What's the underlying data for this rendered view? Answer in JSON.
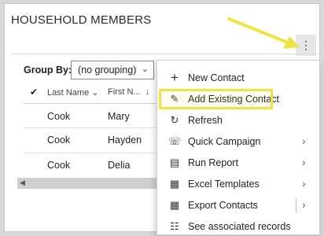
{
  "panel": {
    "title": "HOUSEHOLD MEMBERS",
    "more_icon": "⋮"
  },
  "grid": {
    "group_by_label": "Group By:",
    "group_by_value": "(no grouping)",
    "columns": [
      "Last Name",
      "First N..."
    ],
    "rows": [
      {
        "last": "Cook",
        "first": "Mary"
      },
      {
        "last": "Cook",
        "first": "Hayden"
      },
      {
        "last": "Cook",
        "first": "Delia"
      }
    ]
  },
  "menu": {
    "items": [
      {
        "label": "New Contact",
        "icon": "plus-icon",
        "glyph": "+",
        "has_submenu": false
      },
      {
        "label": "Add Existing Contact",
        "icon": "clipboard-edit-icon",
        "glyph": "✎",
        "has_submenu": false,
        "highlighted": true
      },
      {
        "label": "Refresh",
        "icon": "refresh-icon",
        "glyph": "↻",
        "has_submenu": false
      },
      {
        "label": "Quick Campaign",
        "icon": "campaign-icon",
        "glyph": "☏",
        "has_submenu": true
      },
      {
        "label": "Run Report",
        "icon": "report-icon",
        "glyph": "▤",
        "has_submenu": true
      },
      {
        "label": "Excel Templates",
        "icon": "excel-icon",
        "glyph": "▦",
        "has_submenu": true
      },
      {
        "label": "Export Contacts",
        "icon": "export-excel-icon",
        "glyph": "▦",
        "has_submenu": true,
        "split": true
      },
      {
        "label": "See associated records",
        "icon": "associated-records-icon",
        "glyph": "☷",
        "has_submenu": false
      }
    ]
  },
  "colors": {
    "highlight": "#f0e442",
    "annotation_arrow": "#f0e442"
  }
}
